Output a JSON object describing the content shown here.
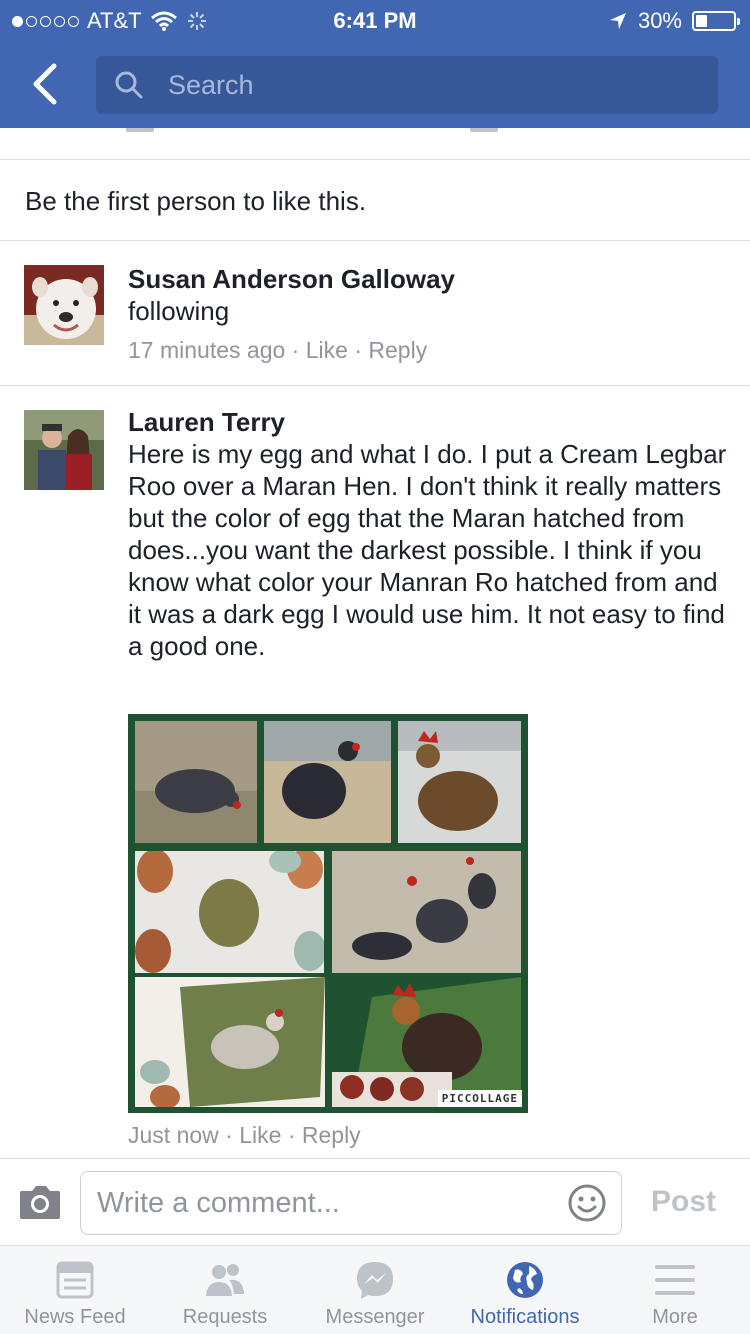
{
  "status_bar": {
    "carrier": "AT&T",
    "time": "6:41 PM",
    "battery": "30%",
    "battery_level": 0.3
  },
  "header": {
    "search_placeholder": "Search"
  },
  "likes_summary": "Be the first person to like this.",
  "comments": [
    {
      "author": "Susan Anderson Galloway",
      "text": "following",
      "time": "17 minutes ago",
      "like_label": "Like",
      "reply_label": "Reply"
    },
    {
      "author": "Lauren Terry",
      "text": "Here is my egg and what I do. I put a Cream Legbar Roo over a Maran Hen. I don't think it really matters but the color of egg that the Maran hatched from does...you want the darkest possible.  I think if you know what color your Manran Ro hatched from and it was a dark egg I would use him.  It not easy to find a good one.",
      "time": "Just now",
      "like_label": "Like",
      "reply_label": "Reply",
      "collage_watermark": "PICCOLLAGE"
    }
  ],
  "composer": {
    "placeholder": "Write a comment...",
    "post_label": "Post"
  },
  "tabs": [
    {
      "label": "News Feed",
      "icon": "news-feed-icon"
    },
    {
      "label": "Requests",
      "icon": "requests-icon"
    },
    {
      "label": "Messenger",
      "icon": "messenger-icon"
    },
    {
      "label": "Notifications",
      "icon": "globe-icon",
      "active": true
    },
    {
      "label": "More",
      "icon": "menu-icon"
    }
  ],
  "colors": {
    "brand": "#4267b2",
    "search_bg": "#365899",
    "meta_text": "#90949c",
    "collage_border": "#1f5230"
  }
}
